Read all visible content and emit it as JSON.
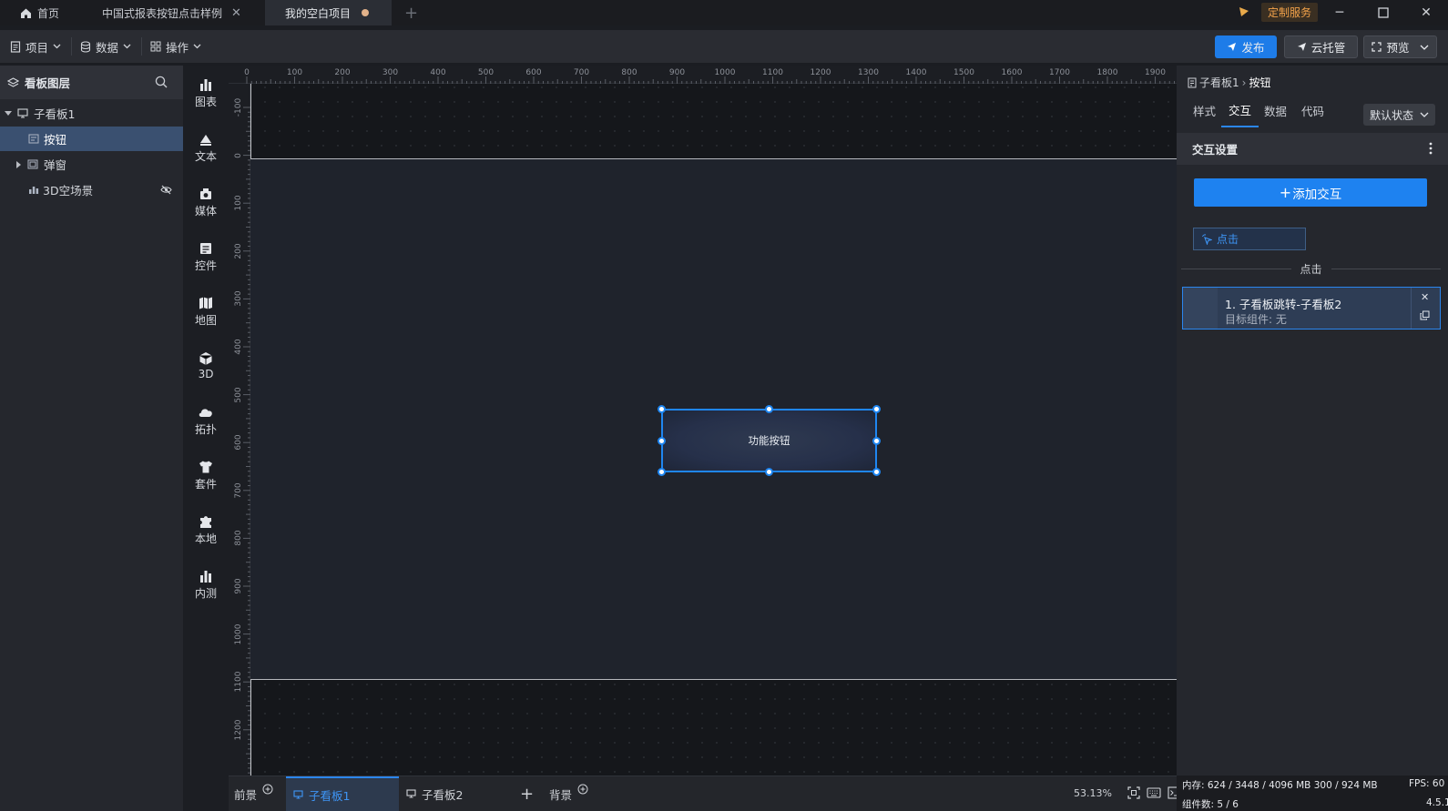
{
  "titlebar": {
    "tabs": [
      {
        "label": "首页"
      },
      {
        "label": "中国式报表按钮点击样例"
      },
      {
        "label": "我的空白项目"
      }
    ],
    "custom_service": "定制服务"
  },
  "menubar": {
    "project": "项目",
    "data": "数据",
    "operate": "操作",
    "publish": "发布",
    "cloud": "云托管",
    "preview": "预览"
  },
  "layers": {
    "title": "看板图层",
    "items": [
      {
        "label": "子看板1"
      },
      {
        "label": "按钮"
      },
      {
        "label": "弹窗"
      },
      {
        "label": "3D空场景"
      }
    ]
  },
  "components": [
    {
      "label": "图表"
    },
    {
      "label": "文本"
    },
    {
      "label": "媒体"
    },
    {
      "label": "控件"
    },
    {
      "label": "地图"
    },
    {
      "label": "3D"
    },
    {
      "label": "拓扑"
    },
    {
      "label": "套件"
    },
    {
      "label": "本地"
    },
    {
      "label": "内测"
    }
  ],
  "ruler": {
    "h": [
      "0",
      "100",
      "200",
      "300",
      "400",
      "500",
      "600",
      "700",
      "800",
      "900",
      "1000",
      "1100",
      "1200",
      "1300",
      "1400",
      "1500",
      "1600",
      "1700",
      "1800",
      "1900"
    ],
    "v": [
      "-100",
      "0",
      "100",
      "200",
      "300",
      "400",
      "500",
      "600",
      "700",
      "800",
      "900",
      "1000",
      "1100",
      "1200"
    ]
  },
  "canvas": {
    "button_label": "功能按钮"
  },
  "bottombar": {
    "foreground": "前景",
    "board1": "子看板1",
    "board2": "子看板2",
    "background": "背景",
    "zoom": "53.13%"
  },
  "right": {
    "breadcrumb_parent": "子看板1",
    "breadcrumb_current": "按钮",
    "tabs": [
      {
        "label": "样式"
      },
      {
        "label": "交互"
      },
      {
        "label": "数据"
      },
      {
        "label": "代码"
      }
    ],
    "state": "默认状态",
    "section_title": "交互设置",
    "add_interaction": "添加交互",
    "click_chip": "点击",
    "divider": "点击",
    "action_title": "1. 子看板跳转-子看板2",
    "action_target": "目标组件: 无"
  },
  "status": {
    "memory": "内存:  624 / 3448 / 4096 MB  300 / 924 MB",
    "fps": "FPS:  60",
    "components": "组件数: 5 / 6",
    "version": "4.5.1"
  },
  "colors": {
    "accent": "#1e82f0",
    "selection": "#1f86f1",
    "custom_service": "#f2a24a"
  }
}
